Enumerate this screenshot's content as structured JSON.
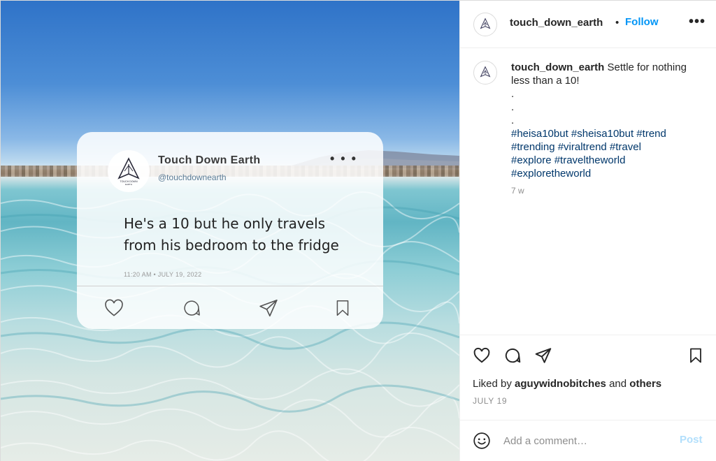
{
  "card": {
    "name": "Touch Down Earth",
    "handle": "@touchdownearth",
    "more": "• • •",
    "text_line1": "He's a 10 but he only travels",
    "text_line2": "from his bedroom to the fridge",
    "timestamp": "11:20 AM  •  JULY 19, 2022",
    "logo_text_top": "TOUCH DOWN",
    "logo_text_bottom": "EARTH",
    "icons": [
      "heart-icon",
      "comment-icon",
      "share-icon",
      "bookmark-icon"
    ]
  },
  "header": {
    "username": "touch_down_earth",
    "separator": "•",
    "follow_label": "Follow",
    "more": "•••"
  },
  "caption": {
    "username": "touch_down_earth",
    "text": " Settle for nothing less than a 10!",
    "dot": ".",
    "hashtags_line1": "#heisa10but #sheisa10but #trend",
    "hashtags_line2": "#trending #viraltrend #travel",
    "hashtags_line3": "#explore #traveltheworld",
    "hashtags_line4": "#exploretheworld",
    "age": "7 w"
  },
  "actions": {
    "icons": [
      "heart-icon",
      "comment-icon",
      "share-icon",
      "bookmark-icon"
    ],
    "liked_prefix": "Liked by ",
    "liked_user": "aguywidnobitches",
    "liked_and": " and ",
    "liked_others": "others",
    "date": "JULY 19"
  },
  "comment": {
    "placeholder": "Add a comment…",
    "post_label": "Post"
  },
  "colors": {
    "accent": "#0095f6",
    "post_disabled": "#b2dffc",
    "hashtag": "#00376b",
    "muted": "#8e8e8e"
  }
}
